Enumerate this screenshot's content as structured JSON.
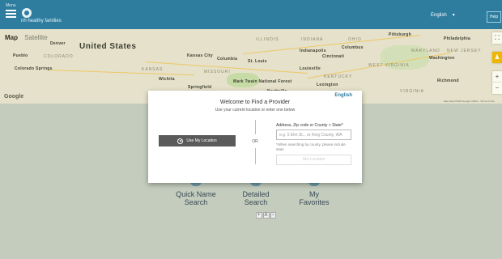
{
  "header": {
    "menu_label": "Menu",
    "brand": "nh healthy families",
    "language": "English",
    "help_label": "Help"
  },
  "map": {
    "map_tab": "Map",
    "satellite_tab": "Satellite",
    "country_label": "United States",
    "google_label": "Google",
    "attribution": "Map data ©2018 Google, INEGI · Terms of Use",
    "shortcuts": "Keyboard shortcuts",
    "labels": [
      {
        "text": "Pittsburgh",
        "cls": "city"
      },
      {
        "text": "Philadelphia",
        "cls": "city"
      },
      {
        "text": "ILLINOIS",
        "cls": "region"
      },
      {
        "text": "INDIANA",
        "cls": "region"
      },
      {
        "text": "OHIO",
        "cls": "region"
      },
      {
        "text": "Indianapolis",
        "cls": "city"
      },
      {
        "text": "Columbus",
        "cls": "city"
      },
      {
        "text": "Cincinnati",
        "cls": "city"
      },
      {
        "text": "MARYLAND",
        "cls": "region"
      },
      {
        "text": "NEW JERSEY",
        "cls": "region"
      },
      {
        "text": "Washington",
        "cls": "city"
      },
      {
        "text": "Denver",
        "cls": "city"
      },
      {
        "text": "COLORADO",
        "cls": "region"
      },
      {
        "text": "KANSAS",
        "cls": "region"
      },
      {
        "text": "Kansas City",
        "cls": "city"
      },
      {
        "text": "Columbia",
        "cls": "city"
      },
      {
        "text": "St. Louis",
        "cls": "city"
      },
      {
        "text": "MISSOURI",
        "cls": "region"
      },
      {
        "text": "Louisville",
        "cls": "city"
      },
      {
        "text": "WEST VIRGINIA",
        "cls": "region"
      },
      {
        "text": "KENTUCKY",
        "cls": "region"
      },
      {
        "text": "Wichita",
        "cls": "city"
      },
      {
        "text": "Springfield",
        "cls": "city"
      },
      {
        "text": "Mark Twain National Forest",
        "cls": "city"
      },
      {
        "text": "Nashville",
        "cls": "city"
      },
      {
        "text": "Lexington",
        "cls": "city"
      },
      {
        "text": "VIRGINIA",
        "cls": "region"
      },
      {
        "text": "Richmond",
        "cls": "city"
      },
      {
        "text": "Pueblo",
        "cls": "city"
      },
      {
        "text": "Colorado Springs",
        "cls": "city"
      }
    ]
  },
  "modal": {
    "language_link": "English",
    "title": "Welcome to Find a Provider",
    "subtitle": "Use your current location or enter one below",
    "use_location_label": "Use My Location",
    "or_label": "OR",
    "address_label": "Address, Zip code or County + State*",
    "address_placeholder": "e.g. 5 Elm St... or King County, WA",
    "address_help": "*When searching by county, please include state",
    "set_location_label": "Set Location"
  },
  "options": [
    {
      "label_line1": "Quick Name",
      "label_line2": "Search"
    },
    {
      "label_line1": "Detailed",
      "label_line2": "Search"
    },
    {
      "label_line1": "My",
      "label_line2": "Favorites"
    }
  ],
  "accessibility": {
    "increase": "+",
    "font": "A",
    "decrease": "−"
  },
  "colors": {
    "header": "#2e7d9f",
    "page_border": "#c9d32a",
    "button_dark": "#5a5a5a",
    "link": "#2e7d9f"
  }
}
